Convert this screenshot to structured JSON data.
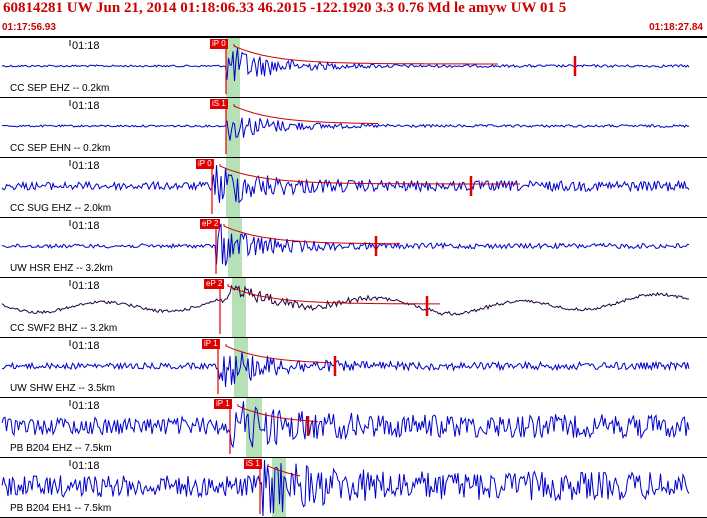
{
  "header": {
    "title": "60814281 UW Jun 21, 2014 01:18:06.33    46.2015 -122.1920  3.3 0.76 Md le amyw UW 01    5",
    "time_start": "01:17:56.93",
    "time_end": "01:18:27.84"
  },
  "colors": {
    "header_text": "#cc0000",
    "trace": "#0000cc",
    "trace_dark": "#220044",
    "pick_bg": "#e00000",
    "window_green": "#b6e0b6",
    "coda_line": "#cc0000"
  },
  "minute_tick_label": "01:18",
  "channels": [
    {
      "label": "CC SEP EHZ -- 0.2km",
      "pick": "iP 0",
      "trace_style": "blue"
    },
    {
      "label": "CC SEP EHN -- 0.2km",
      "pick": "iS 1",
      "trace_style": "blue"
    },
    {
      "label": "CC SUG EHZ -- 2.0km",
      "pick": "iP 0",
      "trace_style": "blue"
    },
    {
      "label": "UW HSR EHZ -- 3.2km",
      "pick": "eP 2",
      "trace_style": "blue"
    },
    {
      "label": "CC SWF2 BHZ -- 3.2km",
      "pick": "eP 2",
      "trace_style": "dark"
    },
    {
      "label": "UW SHW EHZ -- 3.5km",
      "pick": "iP 1",
      "trace_style": "blue"
    },
    {
      "label": "PB B204 EHZ -- 7.5km",
      "pick": "iP 1",
      "trace_style": "blue"
    },
    {
      "label": "PB B204 EH1 -- 7.5km",
      "pick": "iS 1",
      "trace_style": "blue"
    }
  ]
}
